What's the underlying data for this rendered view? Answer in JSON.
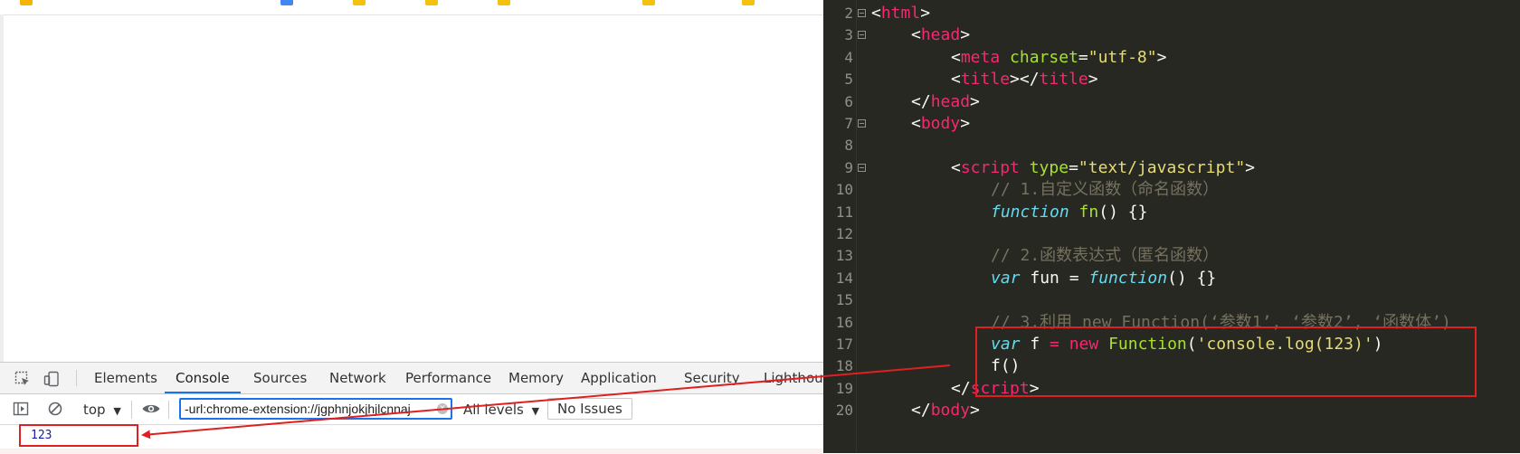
{
  "devtools": {
    "tabs": [
      "Elements",
      "Console",
      "Sources",
      "Network",
      "Performance",
      "Memory",
      "Application",
      "Security",
      "Lighthouse"
    ],
    "active_tab": "Console",
    "toolbar": {
      "context": "top",
      "context_arrow": "▼",
      "filter_value": "-url:chrome-extension://jgphnjokjhjlcnnaj",
      "levels": "All levels",
      "levels_arrow": "▼",
      "issues_button": "No Issues"
    },
    "console_output": "123"
  },
  "editor": {
    "theme": {
      "background": "#272822",
      "tag": "#f92672",
      "attr": "#a6e22e",
      "string": "#e6db74",
      "keyword": "#66d9ef",
      "comment": "#75715e"
    },
    "lines": [
      {
        "num": "2",
        "fold": true
      },
      {
        "num": "3",
        "fold": true
      },
      {
        "num": "4",
        "fold": false
      },
      {
        "num": "5",
        "fold": false
      },
      {
        "num": "6",
        "fold": false
      },
      {
        "num": "7",
        "fold": true
      },
      {
        "num": "8",
        "fold": false
      },
      {
        "num": "9",
        "fold": true
      },
      {
        "num": "10",
        "fold": false
      },
      {
        "num": "11",
        "fold": false
      },
      {
        "num": "12",
        "fold": false
      },
      {
        "num": "13",
        "fold": false
      },
      {
        "num": "14",
        "fold": false
      },
      {
        "num": "15",
        "fold": false
      },
      {
        "num": "16",
        "fold": false
      },
      {
        "num": "17",
        "fold": false
      },
      {
        "num": "18",
        "fold": false
      },
      {
        "num": "19",
        "fold": false
      },
      {
        "num": "20",
        "fold": false
      }
    ],
    "code": {
      "l2_html": "html",
      "l3_head": "head",
      "l4_meta": "meta",
      "l4_charset": "charset",
      "l4_value": "\"utf-8\"",
      "l5_title_open": "title",
      "l5_title_close": "title",
      "l6_head": "head",
      "l7_body": "body",
      "l9_script": "script",
      "l9_type": "type",
      "l9_value": "\"text/javascript\"",
      "l10_comment": "// 1.自定义函数（命名函数）",
      "l11_function": "function",
      "l11_name": "fn",
      "l11_rest": "() {}",
      "l13_comment": "// 2.函数表达式（匿名函数）",
      "l14_var": "var",
      "l14_mid": " fun = ",
      "l14_function": "function",
      "l14_rest": "() {}",
      "l16_comment": "// 3.利用 new Function(‘参数1’, ‘参数2’, ‘函数体’)",
      "l17_var": "var",
      "l17_f": " f ",
      "l17_eq": "=",
      "l17_new": "new",
      "l17_ctor": "Function",
      "l17_arg": "'console.log(123)'",
      "l18_call": "f",
      "l18_paren": "()",
      "l19_script": "script",
      "l20_body": "body"
    }
  },
  "annotations": {
    "color": "#e02020"
  }
}
